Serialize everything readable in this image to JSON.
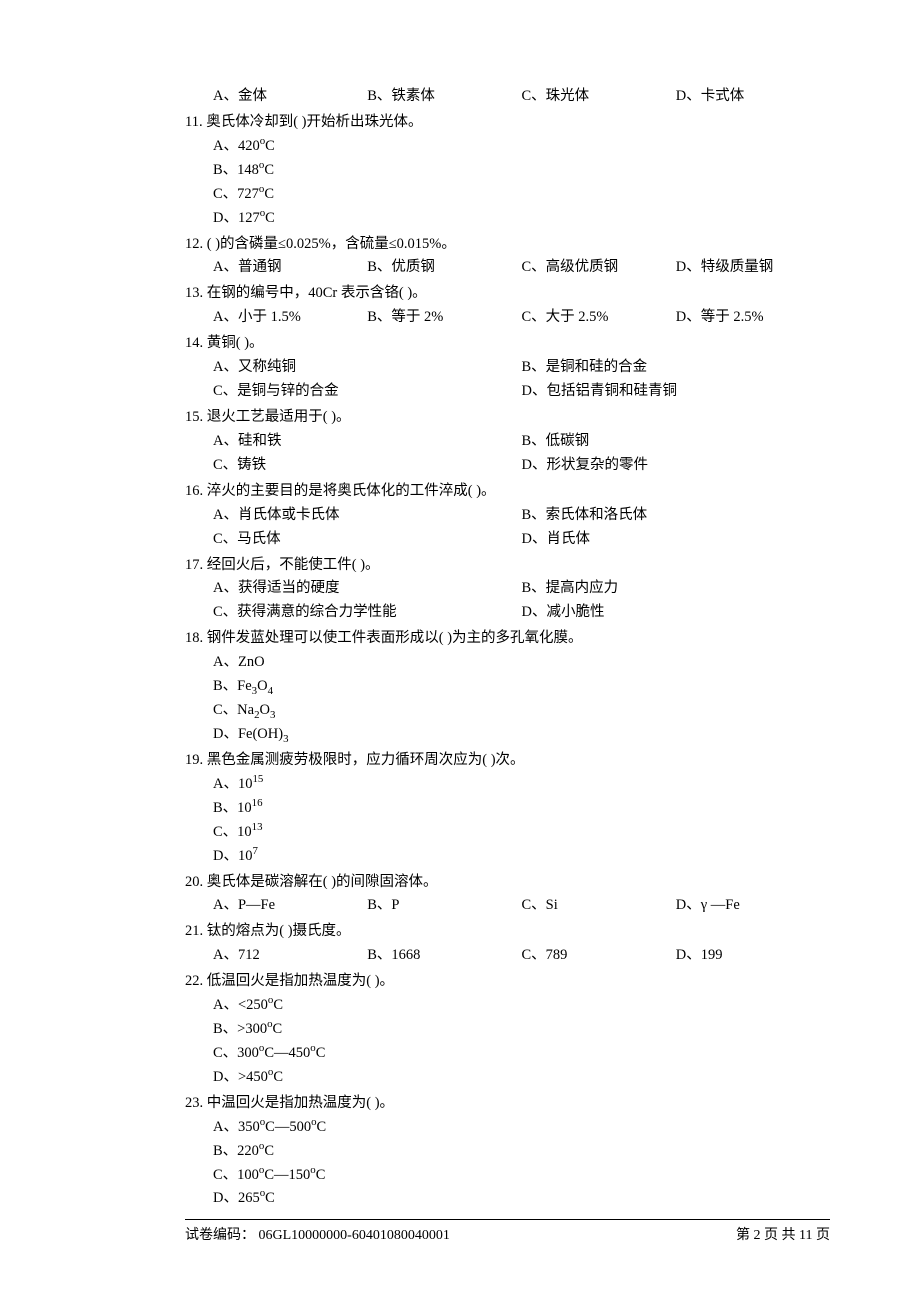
{
  "q10": {
    "opts": {
      "a": "A、金体",
      "b": "B、铁素体",
      "c": "C、珠光体",
      "d": "D、卡式体"
    }
  },
  "q11": {
    "stem": "11. 奥氏体冷却到(      )开始析出珠光体。",
    "opts": {
      "a": "A、420",
      "b": "B、148",
      "c": "C、727",
      "d": "D、127"
    },
    "unit": "C"
  },
  "q12": {
    "stem": "12. (      )的含磷量≤0.025%，含硫量≤0.015%。",
    "opts": {
      "a": "A、普通钢",
      "b": "B、优质钢",
      "c": "C、高级优质钢",
      "d": "D、特级质量钢"
    }
  },
  "q13": {
    "stem": "13. 在钢的编号中，40Cr 表示含铬(      )。",
    "opts": {
      "a": "A、小于 1.5%",
      "b": "B、等于 2%",
      "c": "C、大于 2.5%",
      "d": "D、等于 2.5%"
    }
  },
  "q14": {
    "stem": "14. 黄铜(       )。",
    "opts": {
      "a": "A、又称纯铜",
      "b": "B、是铜和硅的合金",
      "c": "C、是铜与锌的合金",
      "d": "D、包括铝青铜和硅青铜"
    }
  },
  "q15": {
    "stem": "15. 退火工艺最适用于(       )。",
    "opts": {
      "a": "A、硅和铁",
      "b": "B、低碳钢",
      "c": "C、铸铁",
      "d": "D、形状复杂的零件"
    }
  },
  "q16": {
    "stem": "16. 淬火的主要目的是将奥氏体化的工件淬成(       )。",
    "opts": {
      "a": "A、肖氏体或卡氏体",
      "b": "B、索氏体和洛氏体",
      "c": "C、马氏体",
      "d": "D、肖氏体"
    }
  },
  "q17": {
    "stem": "17. 经回火后，不能使工件(       )。",
    "opts": {
      "a": "A、获得适当的硬度",
      "b": "B、提高内应力",
      "c": "C、获得满意的综合力学性能",
      "d": "D、减小脆性"
    }
  },
  "q18": {
    "stem": "18. 钢件发蓝处理可以使工件表面形成以(       )为主的多孔氧化膜。",
    "opts": {
      "a": "A、ZnO",
      "b_pre": "B、Fe",
      "b_sub1": "3",
      "b_mid": "O",
      "b_sub2": "4",
      "c_pre": "C、Na",
      "c_sub1": "2",
      "c_mid": "O",
      "c_sub2": "3",
      "d_pre": "D、Fe(OH)",
      "d_sub": "3"
    }
  },
  "q19": {
    "stem": "19. 黑色金属测疲劳极限时，应力循环周次应为(       )次。",
    "opts": {
      "a_pre": "A、10",
      "a_sup": "15",
      "b_pre": "B、10",
      "b_sup": "16",
      "c_pre": "C、10",
      "c_sup": "13",
      "d_pre": "D、10",
      "d_sup": "7"
    }
  },
  "q20": {
    "stem": "20. 奥氏体是碳溶解在(       )的间隙固溶体。",
    "opts": {
      "a": "A、P—Fe",
      "b": "B、P",
      "c": "C、Si",
      "d": "D、γ —Fe"
    }
  },
  "q21": {
    "stem": "21. 钛的熔点为(       )摄氏度。",
    "opts": {
      "a": "A、712",
      "b": "B、1668",
      "c": "C、789",
      "d": "D、199"
    }
  },
  "q22": {
    "stem": "22. 低温回火是指加热温度为(       )。",
    "opts": {
      "a": "A、<250",
      "b": "B、>300",
      "c": "C、300",
      "c2": "C—450",
      "d": "D、>450"
    },
    "unit": "C"
  },
  "q23": {
    "stem": "23. 中温回火是指加热温度为(       )。",
    "opts": {
      "a": "A、350",
      "a2": "C—500",
      "b": "B、220",
      "c": "C、100",
      "c2": "C—150",
      "d": "D、265"
    },
    "unit": "C"
  },
  "footer": {
    "left": "试卷编码：  06GL10000000-60401080040001",
    "right": "第 2 页  共 11 页"
  },
  "degree_o": "o"
}
